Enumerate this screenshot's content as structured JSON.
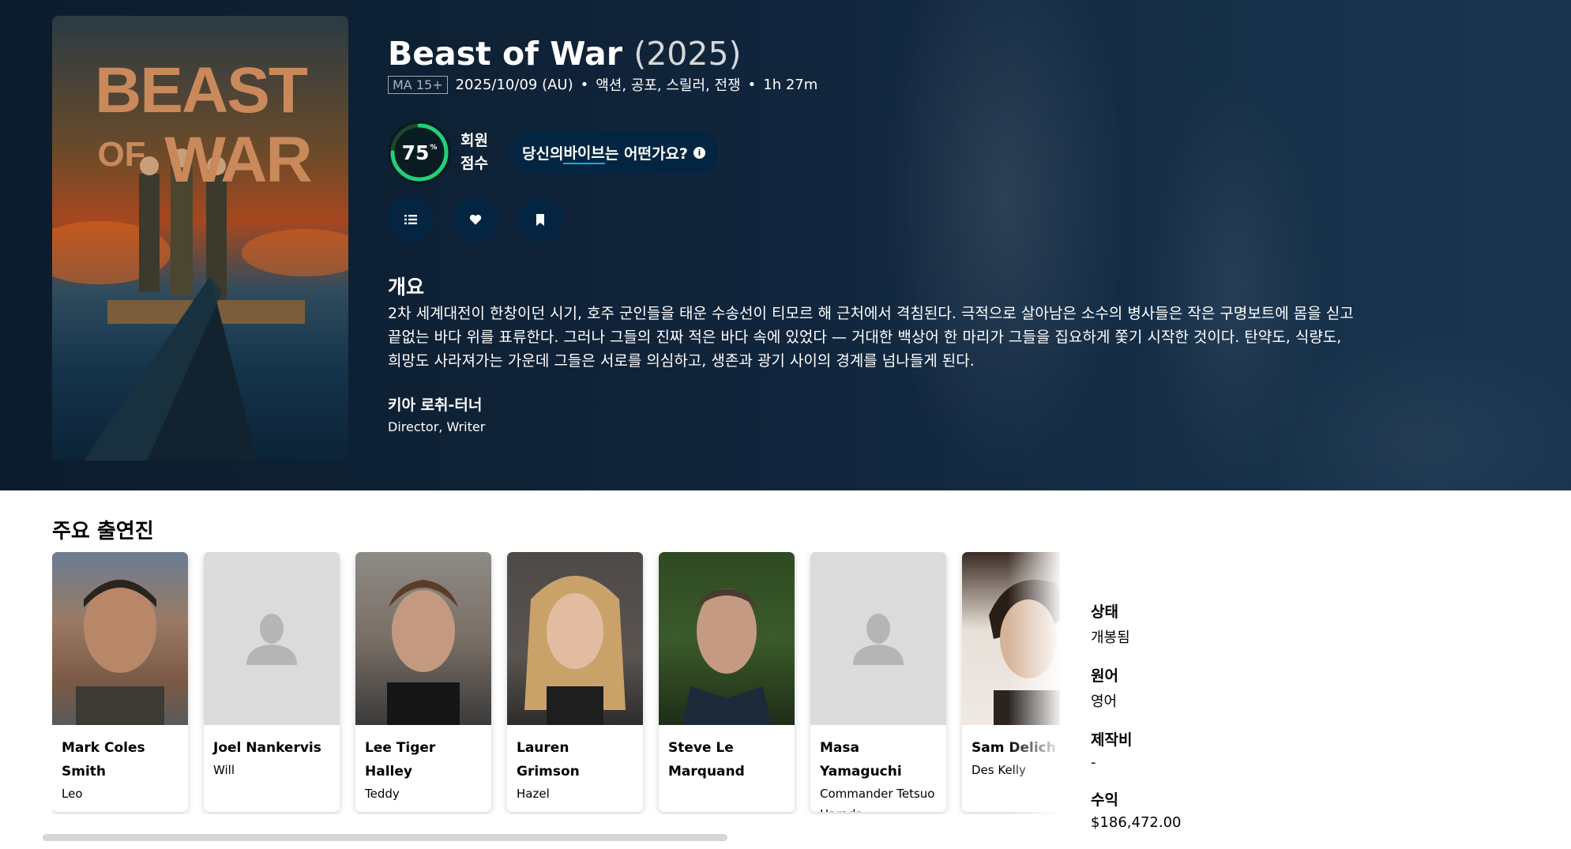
{
  "movie": {
    "title": "Beast of War",
    "year": "(2025)",
    "certification": "MA 15+",
    "release": "2025/10/09 (AU)",
    "genres": "액션, 공포, 스릴러, 전쟁",
    "runtime": "1h 27m",
    "poster_text": [
      "BEAST",
      "OF",
      "WAR"
    ]
  },
  "score": {
    "value": 75,
    "value_text": "75",
    "unit": "%",
    "label": [
      "회원",
      "점수"
    ],
    "color": "#21d07a"
  },
  "vibe": {
    "pre": "당신의 ",
    "underlined": "바이브",
    "post": "는 어떤가요?",
    "info": "i"
  },
  "actions": [
    {
      "name": "add-to-list-button",
      "icon": "list-icon"
    },
    {
      "name": "favorite-button",
      "icon": "heart-icon"
    },
    {
      "name": "watchlist-button",
      "icon": "bookmark-icon"
    }
  ],
  "overview": {
    "heading": "개요",
    "text": "2차 세계대전이 한창이던 시기, 호주 군인들을 태운 수송선이 티모르 해 근처에서 격침된다. 극적으로 살아남은 소수의 병사들은 작은 구명보트에 몸을 싣고 끝없는 바다 위를 표류한다. 그러나 그들의 진짜 적은 바다 속에 있었다 — 거대한 백상어 한 마리가 그들을 집요하게 쫓기 시작한 것이다. 탄약도, 식량도, 희망도 사라져가는 가운데 그들은 서로를 의심하고, 생존과 광기 사이의 경계를 넘나들게 된다."
  },
  "crew": {
    "name": "키아 로취-터너",
    "role": "Director, Writer"
  },
  "cast": {
    "heading": "주요 출연진",
    "members": [
      {
        "name": "Mark Coles Smith",
        "character": "Leo",
        "photo": "photo"
      },
      {
        "name": "Joel Nankervis",
        "character": "Will",
        "photo": "placeholder"
      },
      {
        "name": "Lee Tiger Halley",
        "character": "Teddy",
        "photo": "photo"
      },
      {
        "name": "Lauren Grimson",
        "character": "Hazel",
        "photo": "photo"
      },
      {
        "name": "Steve Le Marquand",
        "character": "",
        "photo": "photo"
      },
      {
        "name": "Masa Yamaguchi",
        "character": "Commander Tetsuo Harada",
        "photo": "placeholder"
      },
      {
        "name": "Sam Delich",
        "character": "Des Kelly",
        "photo": "photo"
      }
    ]
  },
  "facts": {
    "status_label": "상태",
    "status": "개봉됨",
    "language_label": "원어",
    "language": "영어",
    "budget_label": "제작비",
    "budget": "-",
    "revenue_label": "수익",
    "revenue": "$186,472.00"
  }
}
